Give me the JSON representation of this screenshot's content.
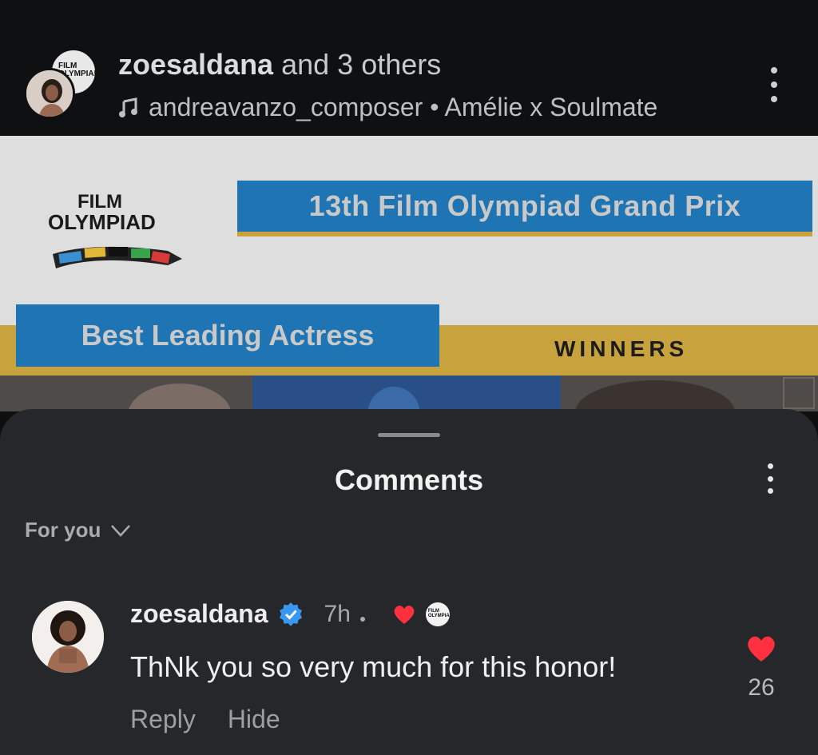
{
  "post": {
    "author": "zoesaldana",
    "coauthors": "and 3 others",
    "music_icon": "music-note-icon",
    "audio": "andreavanzo_composer • Amélie x Soulmate",
    "more_icon": "more-vertical-icon"
  },
  "banner": {
    "logo_line1": "FILM",
    "logo_line2": "OLYMPIAD",
    "title": "13th Film Olympiad Grand Prix",
    "category": "Best Leading Actress",
    "winners": "WINNERS"
  },
  "comments": {
    "title": "Comments",
    "sort_label": "For you",
    "sort_icon": "chevron-down-icon",
    "items": [
      {
        "username": "zoesaldana",
        "verified": true,
        "time": "7h",
        "text": "ThNk you so very much for this honor!",
        "reply_label": "Reply",
        "hide_label": "Hide",
        "likes": "26"
      }
    ]
  },
  "colors": {
    "sheet_bg": "#25272b",
    "banner_blue": "#1f74b4",
    "banner_gold": "#c7a23d",
    "heart_red": "#ff3040",
    "verified_blue": "#3897f0"
  }
}
